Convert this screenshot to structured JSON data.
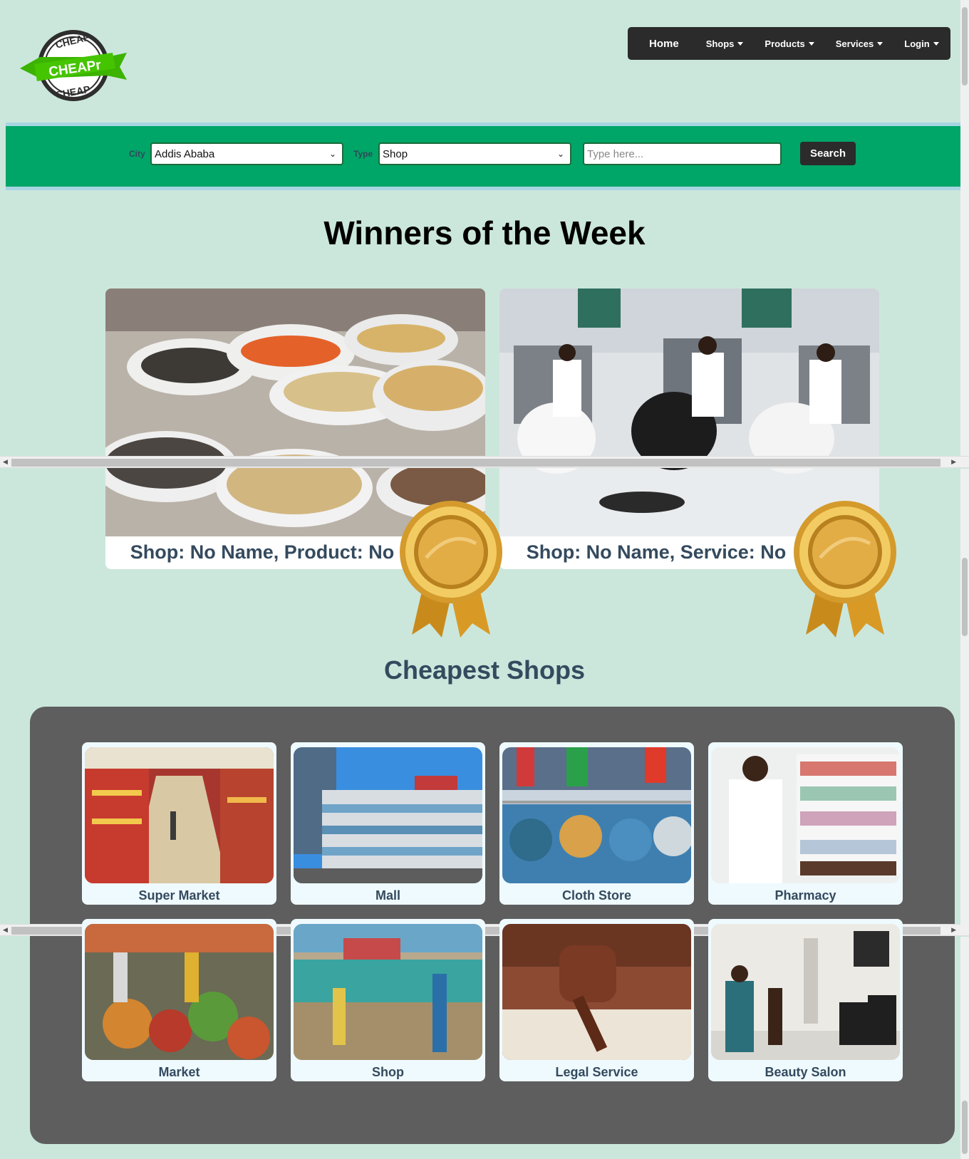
{
  "header": {
    "logo": {
      "top_text": "CHEAP",
      "banner_text": "CHEAPr",
      "bottom_text": "CHEAP"
    },
    "nav": {
      "home": "Home",
      "shops": "Shops",
      "products": "Products",
      "services": "Services",
      "login": "Login"
    }
  },
  "search": {
    "city_label": "City",
    "city_value": "Addis Ababa",
    "type_label": "Type",
    "type_value": "Shop",
    "query_placeholder": "Type here...",
    "button": "Search"
  },
  "winners": {
    "title": "Winners of the Week",
    "cards": [
      {
        "caption": "Shop: No Name, Product: No",
        "image": "grain-sacks"
      },
      {
        "caption": "Shop: No Name, Service: No",
        "image": "barber-shop"
      }
    ]
  },
  "cheapest": {
    "title": "Cheapest Shops",
    "shops": [
      {
        "label": "Super Market"
      },
      {
        "label": "Mall"
      },
      {
        "label": "Cloth Store"
      },
      {
        "label": "Pharmacy"
      },
      {
        "label": "Market"
      },
      {
        "label": "Shop"
      },
      {
        "label": "Legal Service"
      },
      {
        "label": "Beauty Salon"
      }
    ]
  },
  "colors": {
    "background": "#cbe7dc",
    "band": "#00a568",
    "navbar": "#2b2b2b",
    "panel": "#5e5e5e",
    "heading": "#344a5e"
  }
}
